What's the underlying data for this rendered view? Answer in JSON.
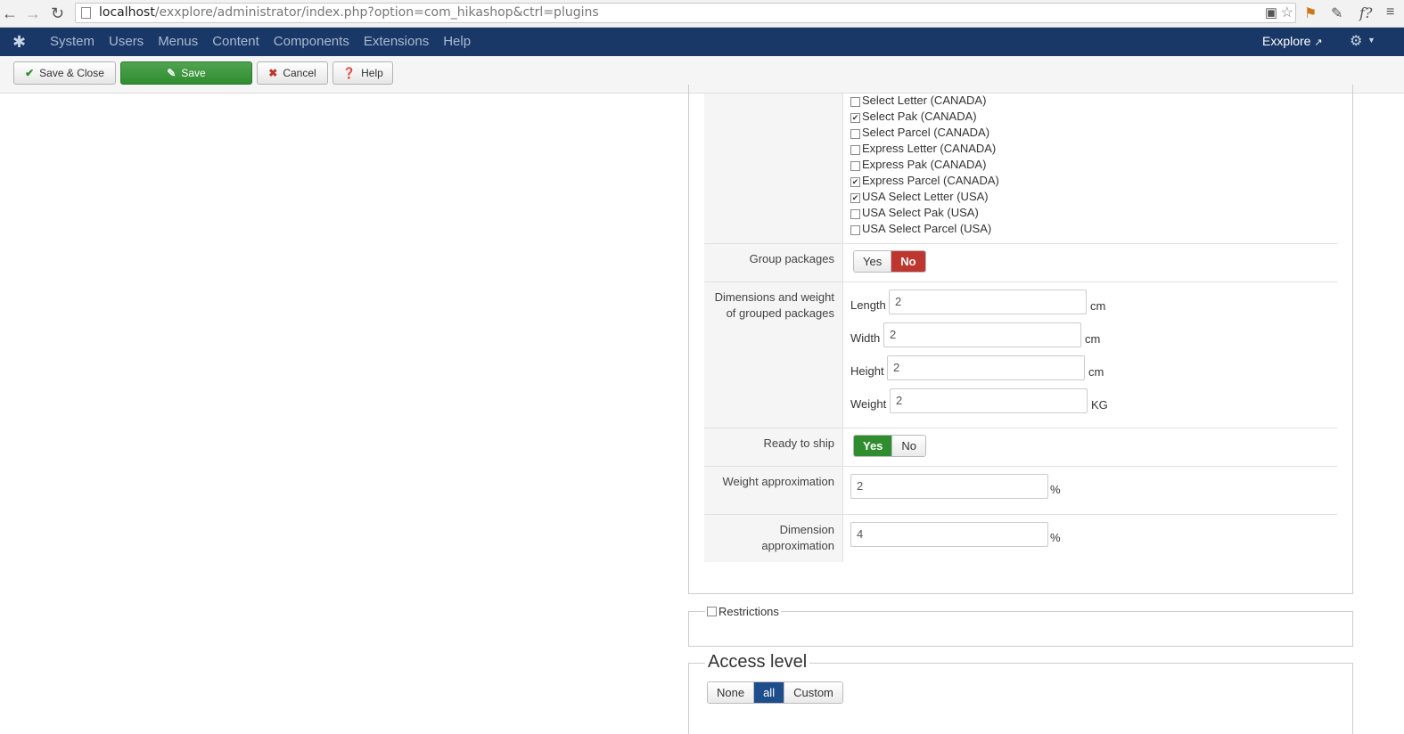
{
  "browser": {
    "url_host": "localhost",
    "url_path": "/exxplore/administrator/index.php?option=com_hikashop&ctrl=plugins"
  },
  "navbar": {
    "menu": [
      "System",
      "Users",
      "Menus",
      "Content",
      "Components",
      "Extensions",
      "Help"
    ],
    "site_name": "Exxplore"
  },
  "toolbar": {
    "save_close": "Save & Close",
    "save": "Save",
    "cancel": "Cancel",
    "help": "Help"
  },
  "services": [
    {
      "label": "Select Letter (CANADA)",
      "checked": false
    },
    {
      "label": "Select Pak (CANADA)",
      "checked": true
    },
    {
      "label": "Select Parcel (CANADA)",
      "checked": false
    },
    {
      "label": "Express Letter (CANADA)",
      "checked": false
    },
    {
      "label": "Express Pak (CANADA)",
      "checked": false
    },
    {
      "label": "Express Parcel (CANADA)",
      "checked": true
    },
    {
      "label": "USA Select Letter (USA)",
      "checked": true
    },
    {
      "label": "USA Select Pak (USA)",
      "checked": false
    },
    {
      "label": "USA Select Parcel (USA)",
      "checked": false
    }
  ],
  "group_packages": {
    "label": "Group packages",
    "yes": "Yes",
    "no": "No",
    "selected": "No"
  },
  "dimensions": {
    "label_line1": "Dimensions and weight",
    "label_line2": "of grouped packages",
    "length": {
      "label": "Length",
      "value": "2",
      "unit": "cm"
    },
    "width": {
      "label": "Width",
      "value": "2",
      "unit": "cm"
    },
    "height": {
      "label": "Height",
      "value": "2",
      "unit": "cm"
    },
    "weight": {
      "label": "Weight",
      "value": "2",
      "unit": "KG"
    }
  },
  "ready_to_ship": {
    "label": "Ready to ship",
    "yes": "Yes",
    "no": "No",
    "selected": "Yes"
  },
  "weight_approximation": {
    "label": "Weight approximation",
    "value": "2",
    "unit": "%"
  },
  "dimension_approximation": {
    "label_line1": "Dimension",
    "label_line2": "approximation",
    "value": "4",
    "unit": "%"
  },
  "restrictions": {
    "label": "Restrictions",
    "checked": false
  },
  "access_level": {
    "title": "Access level",
    "options": [
      "None",
      "all",
      "Custom"
    ],
    "selected": "all"
  }
}
